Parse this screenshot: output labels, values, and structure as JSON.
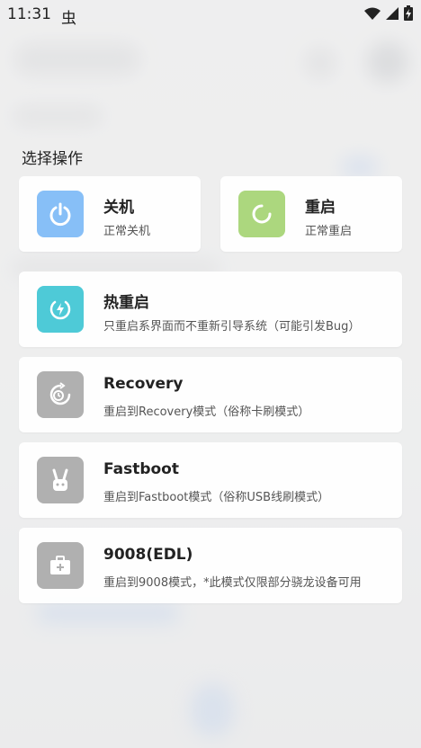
{
  "status_bar": {
    "time": "11:31",
    "bug_glyph": "虫"
  },
  "dialog": {
    "title": "选择操作",
    "options": [
      {
        "title": "关机",
        "subtitle": "正常关机",
        "icon": "power-icon",
        "color": "#87bff7"
      },
      {
        "title": "重启",
        "subtitle": "正常重启",
        "icon": "restart-icon",
        "color": "#acd77e"
      },
      {
        "title": "热重启",
        "subtitle": "只重启系界面而不重新引导系统（可能引发Bug）",
        "icon": "hot-restart-icon",
        "color": "#4ecad7"
      },
      {
        "title": "Recovery",
        "subtitle": "重启到Recovery模式（俗称卡刷模式）",
        "icon": "recovery-icon",
        "color": "#b0b0b0"
      },
      {
        "title": "Fastboot",
        "subtitle": "重启到Fastboot模式（俗称USB线刷模式）",
        "icon": "fastboot-icon",
        "color": "#b0b0b0"
      },
      {
        "title": "9008(EDL)",
        "subtitle": "重启到9008模式，*此模式仅限部分骁龙设备可用",
        "icon": "edl-icon",
        "color": "#b0b0b0"
      }
    ]
  }
}
